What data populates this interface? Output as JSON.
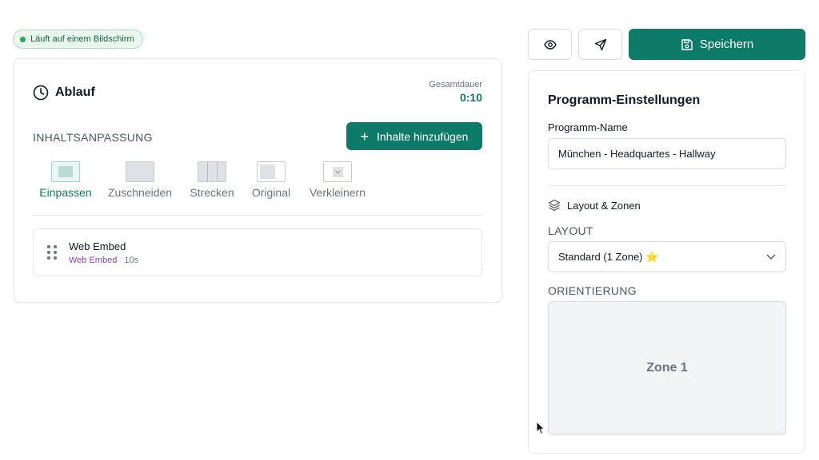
{
  "status": {
    "text": "Läuft auf einem Bildschirm",
    "color": "#22a85a"
  },
  "timeline": {
    "title": "Ablauf",
    "title_icon": "clock-icon",
    "duration_label": "Gesamtdauer",
    "duration_value": "0:10",
    "content_fit_label": "INHALTSANPASSUNG",
    "add_button_label": "Inhalte hinzufügen",
    "fit_options": [
      {
        "label": "Einpassen",
        "active": true
      },
      {
        "label": "Zuschneiden",
        "active": false
      },
      {
        "label": "Strecken",
        "active": false
      },
      {
        "label": "Original",
        "active": false
      },
      {
        "label": "Verkleinern",
        "active": false
      }
    ],
    "items": [
      {
        "title": "Web Embed",
        "type": "Web Embed",
        "duration": "10s"
      }
    ]
  },
  "toolbar": {
    "preview_icon": "eye-icon",
    "send_icon": "send-icon",
    "save_icon": "save-icon",
    "save_label": "Speichern"
  },
  "settings": {
    "title": "Programm-Einstellungen",
    "name_label": "Programm-Name",
    "name_value": "München - Headquartes - Hallway",
    "layout_section_label": "Layout & Zonen",
    "layout_section_icon": "layers-icon",
    "layout_label": "LAYOUT",
    "layout_value": "Standard (1 Zone) ⭐",
    "orientation_label": "ORIENTIERUNG",
    "zone_label": "Zone 1"
  },
  "colors": {
    "accent": "#0e7a68",
    "tag_purple": "#8b3fc4"
  }
}
